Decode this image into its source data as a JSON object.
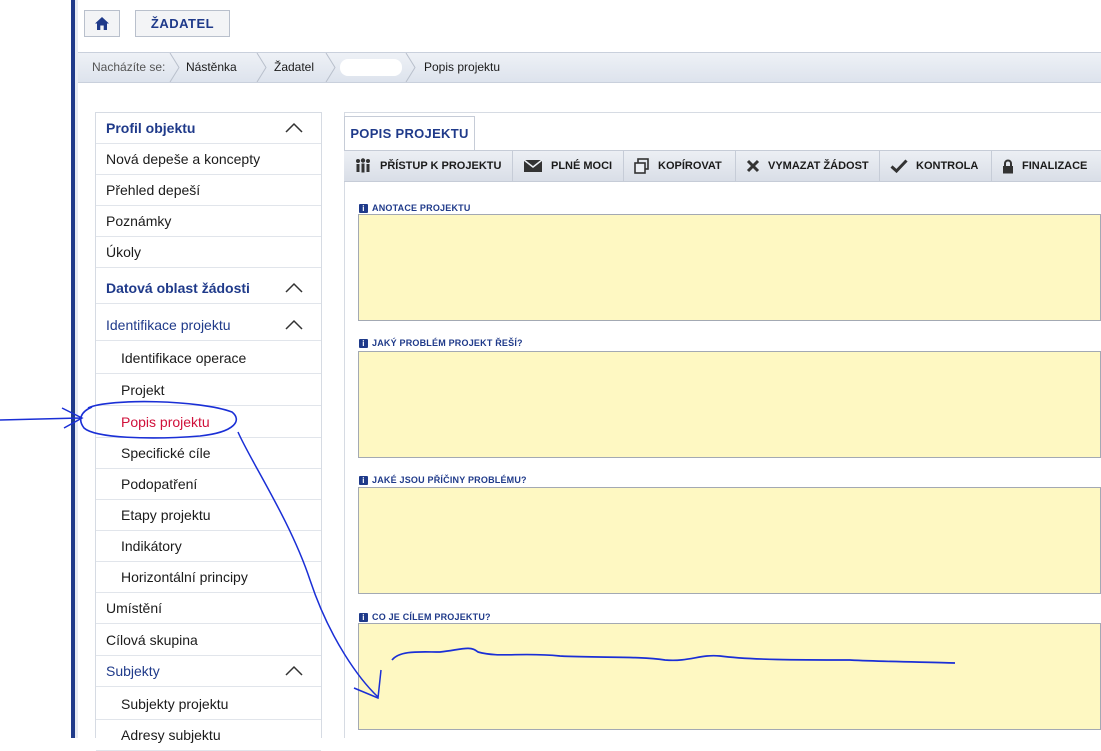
{
  "header": {
    "home_icon": "home-icon",
    "role_button": "ŽADATEL"
  },
  "breadcrumb": {
    "prefix": "Nacházíte se:",
    "items": [
      "Nástěnka",
      "Žadatel",
      "Popis projektu"
    ]
  },
  "sidebar": {
    "items": [
      {
        "label": "Profil objektu"
      },
      {
        "label": "Nová depeše a koncepty"
      },
      {
        "label": "Přehled depeší"
      },
      {
        "label": "Poznámky"
      },
      {
        "label": "Úkoly"
      },
      {
        "label": "Datová oblast žádosti"
      },
      {
        "label": "Identifikace projektu"
      },
      {
        "label": "Identifikace operace"
      },
      {
        "label": "Projekt"
      },
      {
        "label": "Popis projektu"
      },
      {
        "label": "Specifické cíle"
      },
      {
        "label": "Podopatření"
      },
      {
        "label": "Etapy projektu"
      },
      {
        "label": "Indikátory"
      },
      {
        "label": "Horizontální principy"
      },
      {
        "label": "Umístění"
      },
      {
        "label": "Cílová skupina"
      },
      {
        "label": "Subjekty"
      },
      {
        "label": "Subjekty projektu"
      },
      {
        "label": "Adresy subjektu"
      }
    ]
  },
  "main": {
    "tab_label": "POPIS PROJEKTU",
    "toolbar": [
      {
        "label": "PŘÍSTUP K PROJEKTU",
        "icon": "people-icon"
      },
      {
        "label": "PLNÉ MOCI",
        "icon": "envelope-icon"
      },
      {
        "label": "KOPÍROVAT",
        "icon": "copy-icon"
      },
      {
        "label": "VYMAZAT ŽÁDOST",
        "icon": "x-icon"
      },
      {
        "label": "KONTROLA",
        "icon": "check-icon"
      },
      {
        "label": "FINALIZACE",
        "icon": "lock-icon"
      }
    ],
    "fields": [
      {
        "label": "ANOTACE PROJEKTU",
        "value": ""
      },
      {
        "label": "JAKÝ PROBLÉM PROJEKT ŘEŠÍ?",
        "value": ""
      },
      {
        "label": "JAKÉ JSOU PŘÍČINY PROBLÉMU?",
        "value": ""
      },
      {
        "label": "CO JE CÍLEM PROJEKTU?",
        "value": ""
      }
    ],
    "info_icon_glyph": "i"
  },
  "colors": {
    "accent": "#1f3a8a",
    "active": "#d0103a",
    "field_bg": "#fef8c2",
    "annotation": "#1a2fd6"
  }
}
